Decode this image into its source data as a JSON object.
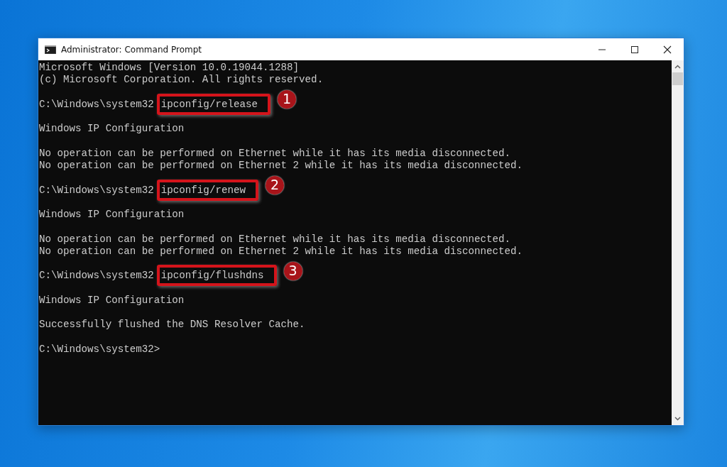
{
  "window": {
    "title": "Administrator: Command Prompt"
  },
  "console": {
    "lines": [
      {
        "kind": "text",
        "text": "Microsoft Windows [Version 10.0.19044.1288]"
      },
      {
        "kind": "text",
        "text": "(c) Microsoft Corporation. All rights reserved."
      },
      {
        "kind": "blank"
      },
      {
        "kind": "command",
        "prompt": "C:\\Windows\\system32",
        "command": "ipconfig/release",
        "marker": "1"
      },
      {
        "kind": "blank"
      },
      {
        "kind": "text",
        "text": "Windows IP Configuration"
      },
      {
        "kind": "blank"
      },
      {
        "kind": "text",
        "text": "No operation can be performed on Ethernet while it has its media disconnected."
      },
      {
        "kind": "text",
        "text": "No operation can be performed on Ethernet 2 while it has its media disconnected."
      },
      {
        "kind": "blank"
      },
      {
        "kind": "command",
        "prompt": "C:\\Windows\\system32",
        "command": "ipconfig/renew",
        "marker": "2"
      },
      {
        "kind": "blank"
      },
      {
        "kind": "text",
        "text": "Windows IP Configuration"
      },
      {
        "kind": "blank"
      },
      {
        "kind": "text",
        "text": "No operation can be performed on Ethernet while it has its media disconnected."
      },
      {
        "kind": "text",
        "text": "No operation can be performed on Ethernet 2 while it has its media disconnected."
      },
      {
        "kind": "blank"
      },
      {
        "kind": "command",
        "prompt": "C:\\Windows\\system32",
        "command": "ipconfig/flushdns",
        "marker": "3"
      },
      {
        "kind": "blank"
      },
      {
        "kind": "text",
        "text": "Windows IP Configuration"
      },
      {
        "kind": "blank"
      },
      {
        "kind": "text",
        "text": "Successfully flushed the DNS Resolver Cache."
      },
      {
        "kind": "blank"
      },
      {
        "kind": "text",
        "text": "C:\\Windows\\system32>"
      }
    ]
  }
}
